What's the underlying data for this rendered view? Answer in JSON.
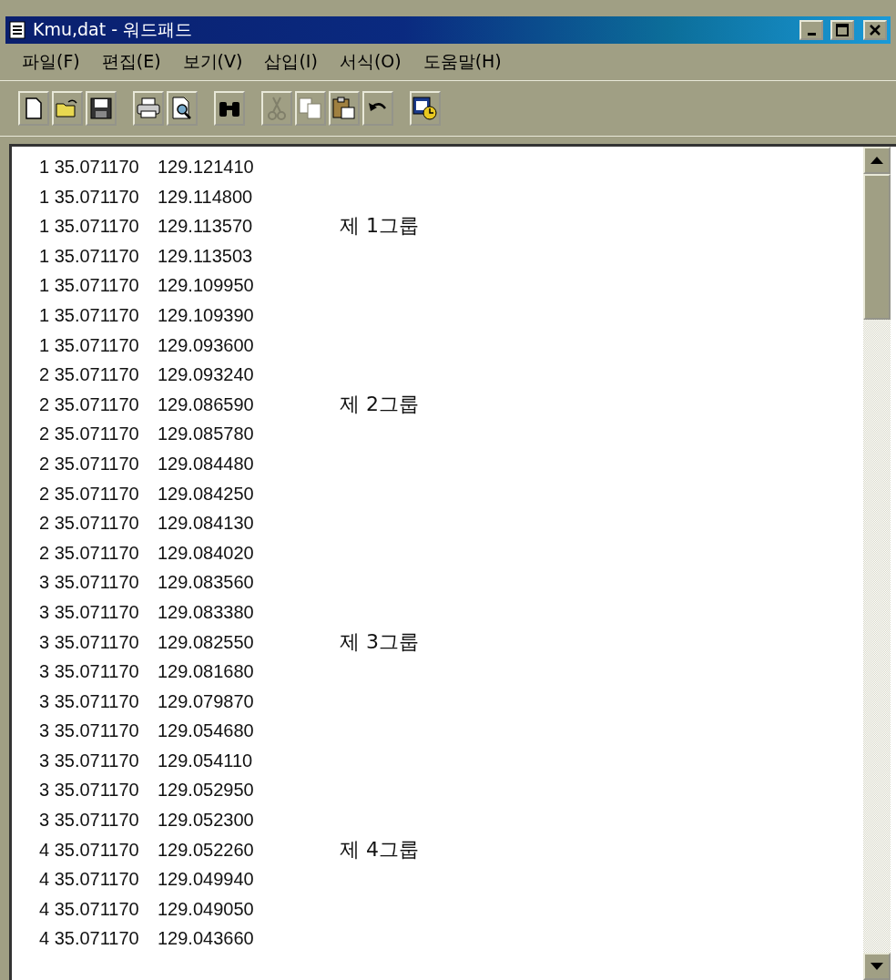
{
  "window": {
    "title": "Kmu,dat - 워드패드"
  },
  "menu": [
    "파일(F)",
    "편집(E)",
    "보기(V)",
    "삽입(I)",
    "서식(O)",
    "도움말(H)"
  ],
  "toolbar": [
    {
      "kind": "new",
      "disabled": false
    },
    {
      "kind": "open",
      "disabled": false
    },
    {
      "kind": "save",
      "disabled": false
    },
    {
      "kind": "sep"
    },
    {
      "kind": "print",
      "disabled": false
    },
    {
      "kind": "preview",
      "disabled": false
    },
    {
      "kind": "sep"
    },
    {
      "kind": "find",
      "disabled": false
    },
    {
      "kind": "sep"
    },
    {
      "kind": "cut",
      "disabled": true
    },
    {
      "kind": "copy",
      "disabled": true
    },
    {
      "kind": "paste",
      "disabled": false
    },
    {
      "kind": "undo",
      "disabled": false
    },
    {
      "kind": "sep"
    },
    {
      "kind": "datetime",
      "disabled": false
    }
  ],
  "document": {
    "lines": [
      {
        "group": "1 35.071170",
        "value": "129.121410"
      },
      {
        "group": "1 35.071170",
        "value": "129.114800"
      },
      {
        "group": "1 35.071170",
        "value": "129.113570",
        "note": "제 1그룹"
      },
      {
        "group": "1 35.071170",
        "value": "129.113503"
      },
      {
        "group": "1 35.071170",
        "value": "129.109950"
      },
      {
        "group": "1 35.071170",
        "value": "129.109390"
      },
      {
        "group": "1 35.071170",
        "value": "129.093600"
      },
      {
        "group": "2 35.071170",
        "value": "129.093240"
      },
      {
        "group": "2 35.071170",
        "value": "129.086590",
        "note": "제 2그룹"
      },
      {
        "group": "2 35.071170",
        "value": "129.085780"
      },
      {
        "group": "2 35.071170",
        "value": "129.084480"
      },
      {
        "group": "2 35.071170",
        "value": "129.084250"
      },
      {
        "group": "2 35.071170",
        "value": "129.084130"
      },
      {
        "group": "2 35.071170",
        "value": "129.084020"
      },
      {
        "group": "3 35.071170",
        "value": "129.083560"
      },
      {
        "group": "3 35.071170",
        "value": "129.083380"
      },
      {
        "group": "3 35.071170",
        "value": "129.082550",
        "note": "제 3그룹"
      },
      {
        "group": "3 35.071170",
        "value": "129.081680"
      },
      {
        "group": "3 35.071170",
        "value": "129.079870"
      },
      {
        "group": "3 35.071170",
        "value": "129.054680"
      },
      {
        "group": "3 35.071170",
        "value": "129.054110"
      },
      {
        "group": "3 35.071170",
        "value": "129.052950"
      },
      {
        "group": "3 35.071170",
        "value": "129.052300"
      },
      {
        "group": "4 35.071170",
        "value": "129.052260",
        "note": "제 4그룹"
      },
      {
        "group": "4 35.071170",
        "value": "129.049940"
      },
      {
        "group": "4 35.071170",
        "value": "129.049050"
      },
      {
        "group": "4 35.071170",
        "value": "129.043660"
      }
    ]
  }
}
